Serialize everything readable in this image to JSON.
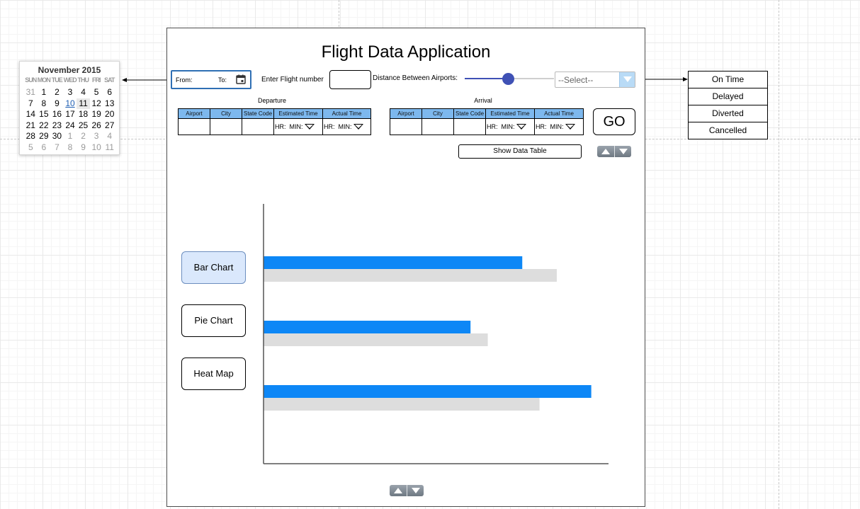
{
  "calendar": {
    "title": "November 2015",
    "weekdays": [
      "SUN",
      "MON",
      "TUE",
      "WED",
      "THU",
      "FRI",
      "SAT"
    ],
    "weeks": [
      [
        "31",
        "1",
        "2",
        "3",
        "4",
        "5",
        "6"
      ],
      [
        "7",
        "8",
        "9",
        "10",
        "11",
        "12",
        "13"
      ],
      [
        "14",
        "15",
        "16",
        "17",
        "18",
        "19",
        "20"
      ],
      [
        "21",
        "22",
        "23",
        "24",
        "25",
        "26",
        "27"
      ],
      [
        "28",
        "29",
        "30",
        "1",
        "2",
        "3",
        "4"
      ],
      [
        "5",
        "6",
        "7",
        "8",
        "9",
        "10",
        "11"
      ]
    ],
    "today": "10",
    "selected": "11"
  },
  "status_options": [
    "On Time",
    "Delayed",
    "Diverted",
    "Cancelled"
  ],
  "app": {
    "title": "Flight Data Application",
    "from_label": "From:",
    "to_label": "To:",
    "flight_number_label": "Enter Flight number",
    "flight_number_value": "",
    "distance_label": "Distance Between Airports:",
    "slider_fraction": 0.46,
    "select_value": "--Select--",
    "go_label": "GO",
    "show_table_label": "Show Data Table"
  },
  "departure": {
    "title": "Departure",
    "columns": [
      "Airport",
      "City",
      "State Code",
      "Estimated Time",
      "Actual Time"
    ],
    "hr_label": "HR:",
    "min_label": "MIN:"
  },
  "arrival": {
    "title": "Arrival",
    "columns": [
      "Airport",
      "City",
      "State Code",
      "Estimated Time",
      "Actual Time"
    ],
    "hr_label": "HR:",
    "min_label": "MIN:"
  },
  "chart_buttons": [
    "Bar Chart",
    "Pie Chart",
    "Heat Map"
  ],
  "colors": {
    "accent_blue": "#0d87f6",
    "secondary_gray": "#dddddd",
    "table_header": "#7db8ee",
    "slider": "#3f51b5"
  },
  "chart_data": {
    "type": "bar",
    "orientation": "horizontal",
    "categories": [
      "",
      "",
      ""
    ],
    "series": [
      {
        "values": [
          75,
          60,
          95
        ]
      },
      {
        "values": [
          85,
          65,
          80
        ]
      }
    ],
    "xlim": [
      0,
      100
    ],
    "grid": false,
    "legend": "none"
  }
}
